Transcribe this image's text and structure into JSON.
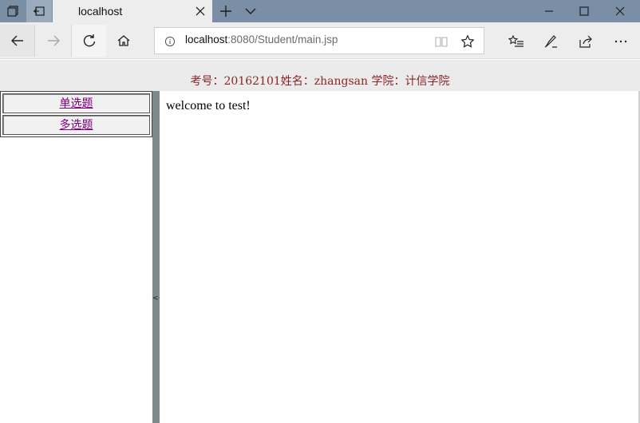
{
  "browser": {
    "tab": {
      "title": "localhost"
    },
    "address": {
      "host": "localhost",
      "rest": ":8080/Student/main.jsp"
    },
    "icons": {
      "tab_actions": "tab-actions-icon",
      "set_aside": "set-tabs-aside-icon",
      "close_tab": "close-icon",
      "new_tab": "plus-icon",
      "tab_preview": "chevron-down-icon",
      "minimize": "minimize-icon",
      "maximize": "maximize-icon",
      "close_window": "close-icon",
      "back": "back-arrow-icon",
      "forward": "forward-arrow-icon",
      "refresh": "refresh-icon",
      "home": "home-icon",
      "info": "info-icon",
      "reading_view": "book-icon",
      "favorite": "star-icon",
      "favorites_hub": "favorites-list-icon",
      "notes": "pen-icon",
      "share": "share-icon",
      "more": "more-icon"
    }
  },
  "page": {
    "student_info": "考号：20162101姓名：zhangsan 学院：计信学院",
    "menu": [
      {
        "label": "单选题"
      },
      {
        "label": "多选题"
      }
    ],
    "splitter_arrow": "<<",
    "welcome": "welcome to test!"
  },
  "colors": {
    "titlebar": "#7a8fa6",
    "header_text": "#8b2525",
    "link_visited": "#800080",
    "splitter": "#7c898d"
  }
}
